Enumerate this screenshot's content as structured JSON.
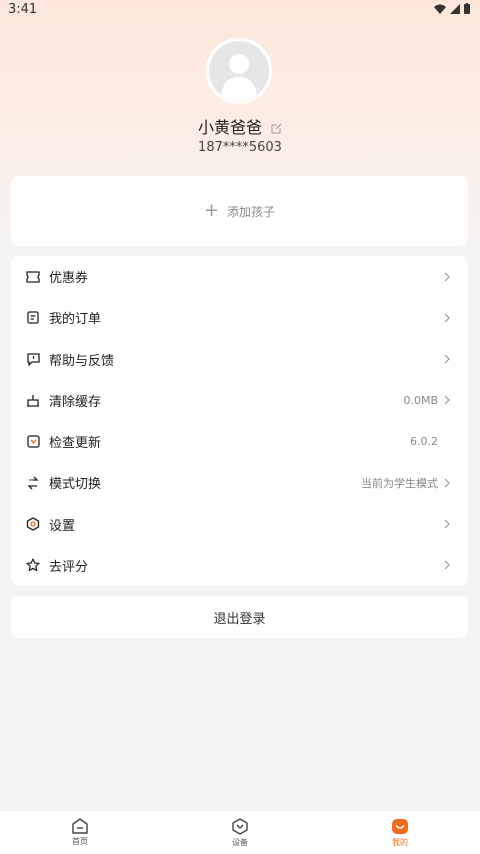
{
  "status": {
    "time": "3:41"
  },
  "profile": {
    "name": "小黄爸爸",
    "phone": "187****5603"
  },
  "add_child": {
    "label": "添加孩子"
  },
  "menu": [
    {
      "label": "优惠券",
      "value": "",
      "icon": "ticket-icon"
    },
    {
      "label": "我的订单",
      "value": "",
      "icon": "order-icon"
    },
    {
      "label": "帮助与反馈",
      "value": "",
      "icon": "feedback-icon"
    },
    {
      "label": "清除缓存",
      "value": "0.0MB",
      "icon": "clear-cache-icon"
    },
    {
      "label": "检查更新",
      "value": "6.0.2",
      "icon": "update-icon"
    },
    {
      "label": "模式切换",
      "value": "当前为学生模式",
      "icon": "switch-icon"
    },
    {
      "label": "设置",
      "value": "",
      "icon": "settings-icon"
    },
    {
      "label": "去评分",
      "value": "",
      "icon": "star-icon"
    }
  ],
  "logout": {
    "label": "退出登录"
  },
  "tabs": [
    {
      "label": "首页",
      "icon": "home-icon",
      "active": false
    },
    {
      "label": "设备",
      "icon": "device-icon",
      "active": false
    },
    {
      "label": "我的",
      "icon": "profile-icon",
      "active": true
    }
  ],
  "colors": {
    "accent": "#f26b1d",
    "background": "#f4f4f4",
    "header_tint": "#fde7dc"
  }
}
